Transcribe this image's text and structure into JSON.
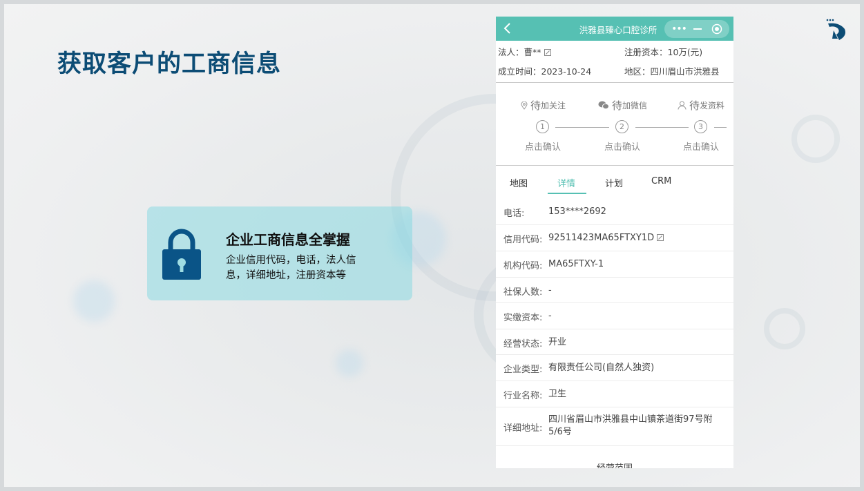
{
  "slide": {
    "title": "获取客户的工商信息",
    "feature": {
      "title": "企业工商信息全掌握",
      "desc": "企业信用代码，电话，法人信息，详细地址，注册资本等"
    }
  },
  "phone": {
    "nav_title": "洪雅县臻心口腔诊所",
    "header": {
      "legal_person": "法人：曹**",
      "capital": "注册资本：10万(元)",
      "founded": "成立时间：2023-10-24",
      "region": "地区：四川眉山市洪雅县"
    },
    "tasks": [
      {
        "prefix": "待",
        "label": "加关注",
        "step": "1",
        "confirm": "点击确认"
      },
      {
        "prefix": "待",
        "label": "加微信",
        "step": "2",
        "confirm": "点击确认"
      },
      {
        "prefix": "待",
        "label": "发资料",
        "step": "3",
        "confirm": "点击确认"
      }
    ],
    "tabs": [
      "地图",
      "详情",
      "计划",
      "CRM"
    ],
    "active_tab": "详情",
    "details": [
      {
        "key": "电话:",
        "value": "153****2692"
      },
      {
        "key": "信用代码:",
        "value": "92511423MA65FTXY1D"
      },
      {
        "key": "机构代码:",
        "value": "MA65FTXY-1"
      },
      {
        "key": "社保人数:",
        "value": "-"
      },
      {
        "key": "实缴资本:",
        "value": "-"
      },
      {
        "key": "经营状态:",
        "value": "开业"
      },
      {
        "key": "企业类型:",
        "value": "有限责任公司(自然人独资)"
      },
      {
        "key": "行业名称:",
        "value": "卫生"
      },
      {
        "key": "详细地址:",
        "value": "四川省眉山市洪雅县中山镇茶道街97号附5/6号"
      }
    ],
    "section_title": "经营范围"
  },
  "colors": {
    "title": "#0c4c75",
    "accent": "#56c0b3",
    "card": "#9fdde3"
  }
}
